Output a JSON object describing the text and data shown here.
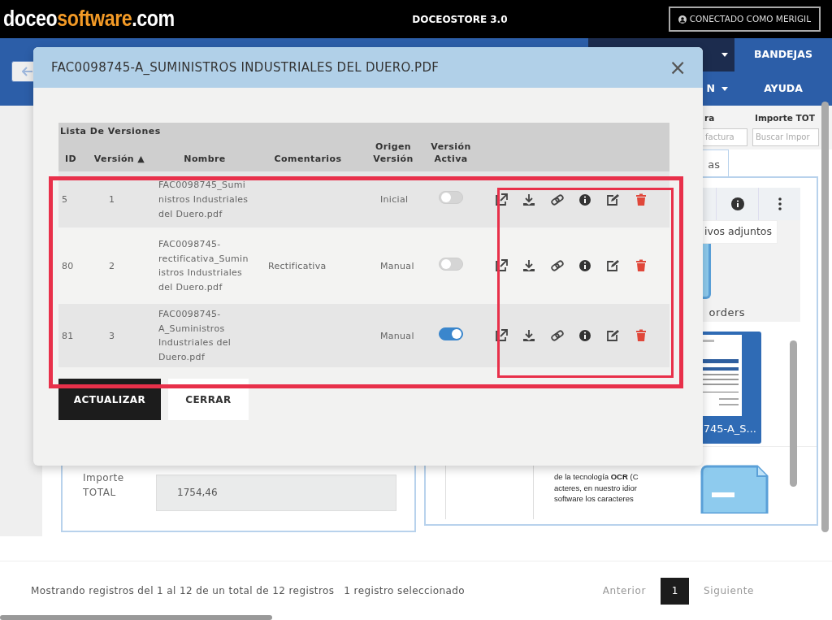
{
  "header": {
    "logo": [
      {
        "text": "doceo",
        "accent": false
      },
      {
        "text": "software",
        "accent": true
      },
      {
        "text": ".com",
        "accent": false
      }
    ],
    "title": "DOCEOSTORE 3.0",
    "user_button": "CONECTADO COMO MERIGIL"
  },
  "nav": {
    "top_items": [
      {
        "label": "BANDEJAS"
      }
    ],
    "bottom_items": [
      {
        "label": "N",
        "dropdown": true
      },
      {
        "label": "AYUDA",
        "dropdown": false
      }
    ]
  },
  "background": {
    "filters": [
      {
        "heading": "ra",
        "placeholder": "factura"
      },
      {
        "heading": "Importe TOT",
        "placeholder": "Buscar Impor"
      }
    ],
    "tab": "as",
    "attachments_button": "ivos adjuntos",
    "folder_label": "orders",
    "document_label": "745-A_S...",
    "form": {
      "label": "Importe TOTAL",
      "value": "1754,46"
    },
    "document_text": [
      "de la tecnología **OCR** (C",
      "acteres, en nuestro idior",
      "software los caracteres"
    ]
  },
  "modal": {
    "title": "FAC0098745-A_SUMINISTROS INDUSTRIALES DEL DUERO.PDF",
    "close": "×",
    "caption": "Lista De Versiones",
    "columns": [
      "ID",
      "Versión ▲",
      "Nombre",
      "Comentarios",
      "Origen Versión",
      "Versión Activa"
    ],
    "rows": [
      {
        "id": "5",
        "version": "1",
        "name": "FAC0098745_Suministros Industriales del Duero.pdf",
        "origin": "Inicial",
        "active": false
      },
      {
        "id": "80",
        "version": "2",
        "name": "FAC0098745-rectificativa_Suministros Industriales del Duero.pdf",
        "comment": "Rectificativa",
        "origin": "Manual",
        "active": false
      },
      {
        "id": "81",
        "version": "3",
        "name": "FAC0098745-A_Suministros Industriales del Duero.pdf",
        "origin": "Manual",
        "active": true
      }
    ],
    "highlights": {
      "rows_framed": true,
      "actions_framed": true
    },
    "buttons": [
      {
        "label": "ACTUALIZAR",
        "kind": "primary"
      },
      {
        "label": "CERRAR",
        "kind": "secondary"
      }
    ]
  },
  "footer": {
    "info": "Mostrando registros del 1 al 12 de un total de 12 registros",
    "selection": "1 registro seleccionado",
    "previous": "Anterior",
    "pages": [
      {
        "label": "1",
        "selected": true
      }
    ],
    "next": "Siguiente"
  }
}
